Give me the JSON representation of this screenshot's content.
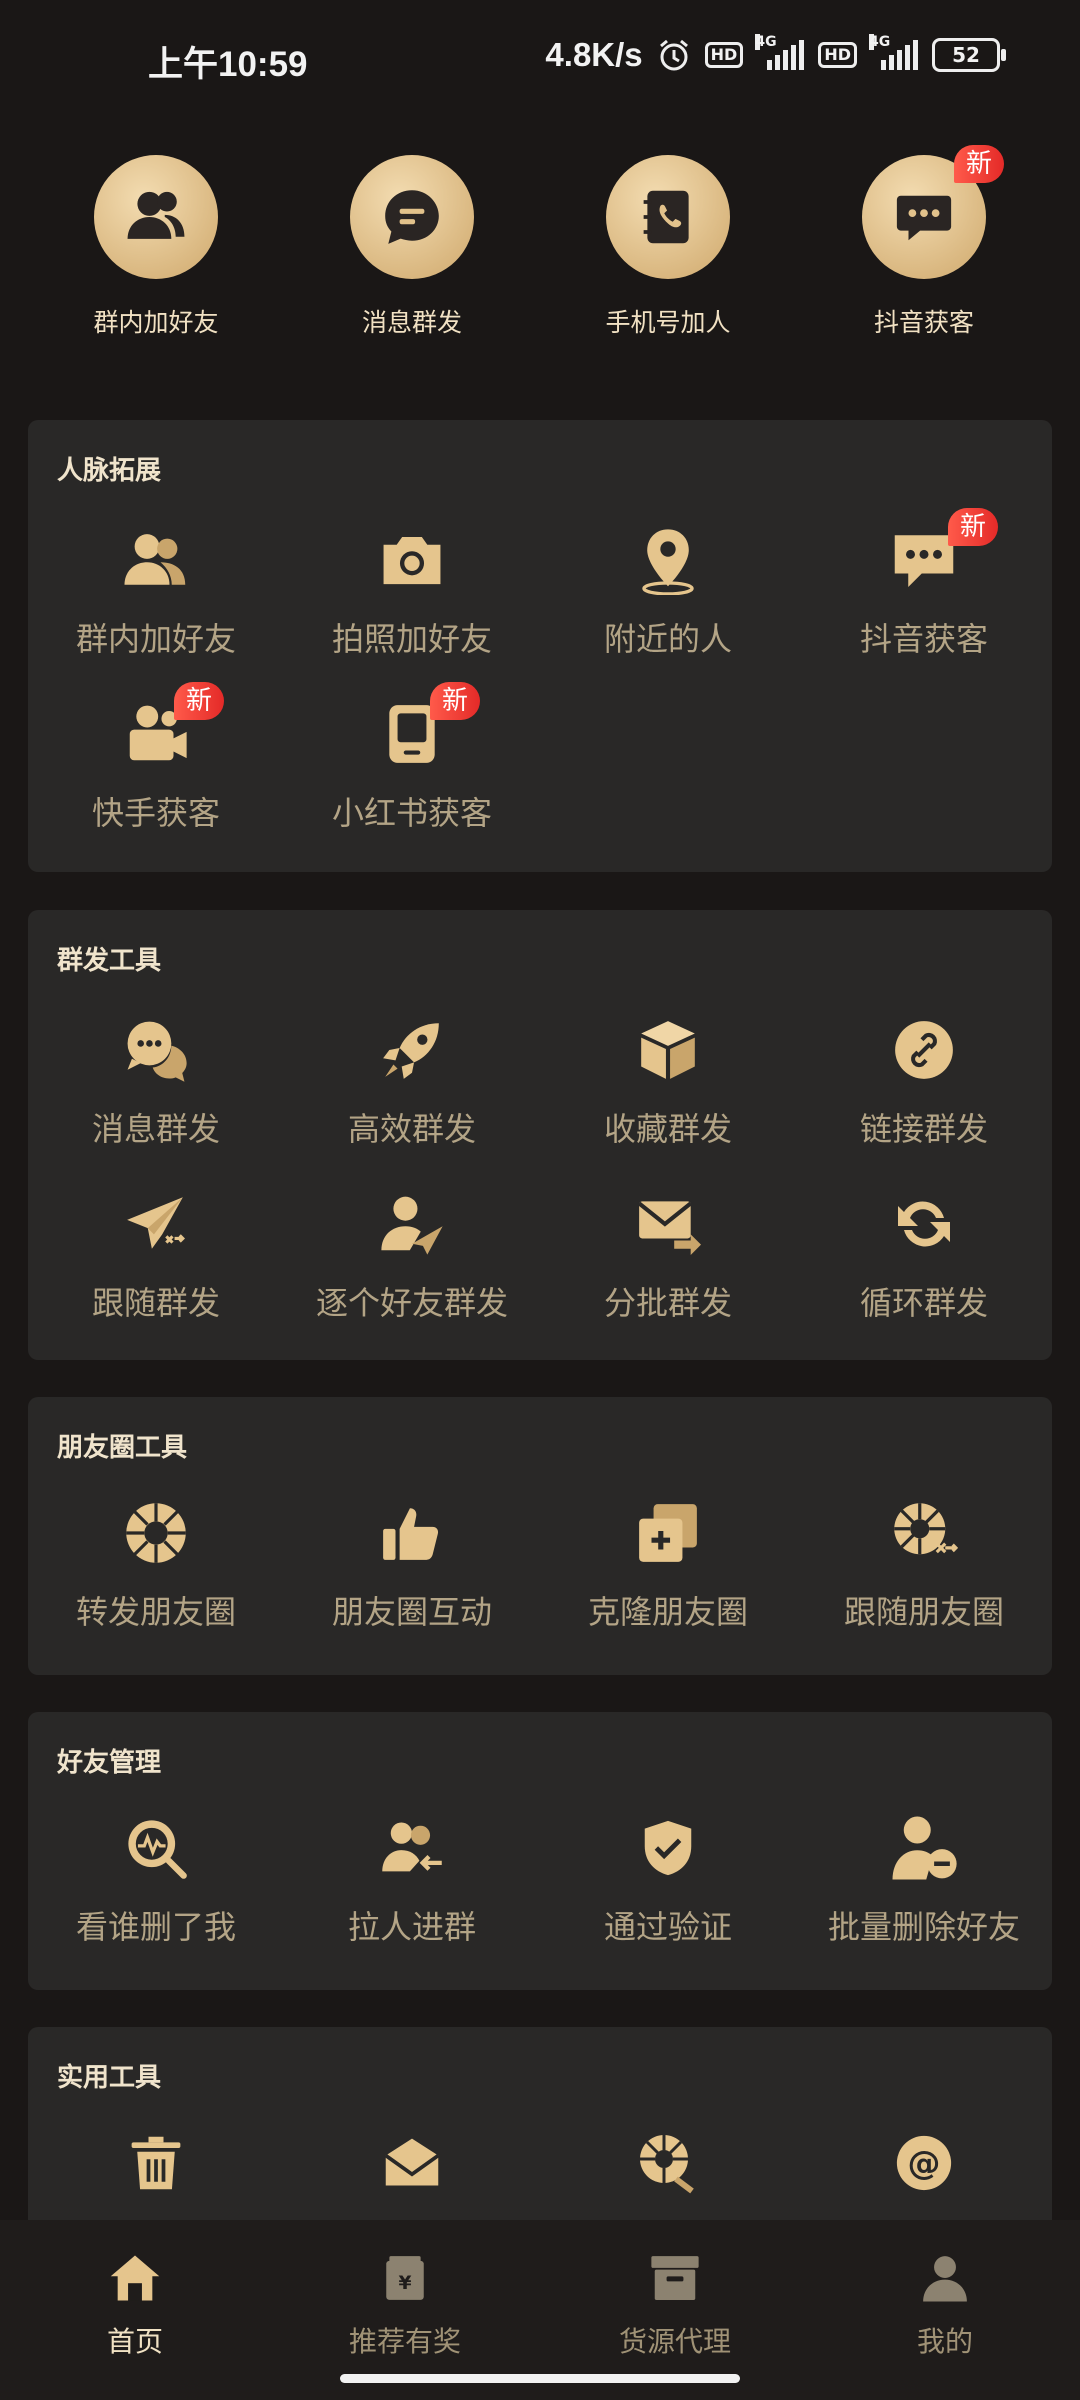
{
  "status": {
    "time": "上午10:59",
    "net_speed": "4.8K/s",
    "hd": "HD",
    "net_type": "4G",
    "battery": "52"
  },
  "quick_actions": [
    {
      "label": "群内加好友",
      "icon": "users-icon"
    },
    {
      "label": "消息群发",
      "icon": "message-icon"
    },
    {
      "label": "手机号加人",
      "icon": "phonebook-icon"
    },
    {
      "label": "抖音获客",
      "icon": "chat-dots-icon",
      "badge": "新"
    }
  ],
  "sections": [
    {
      "title": "人脉拓展",
      "items": [
        {
          "label": "群内加好友",
          "icon": "users-icon"
        },
        {
          "label": "拍照加好友",
          "icon": "camera-icon"
        },
        {
          "label": "附近的人",
          "icon": "location-pin-icon"
        },
        {
          "label": "抖音获客",
          "icon": "chat-dots-icon",
          "badge": "新"
        },
        {
          "label": "快手获客",
          "icon": "video-camera-icon",
          "badge": "新"
        },
        {
          "label": "小红书获客",
          "icon": "book-icon",
          "badge": "新"
        }
      ]
    },
    {
      "title": "群发工具",
      "items": [
        {
          "label": "消息群发",
          "icon": "chat-bubbles-icon"
        },
        {
          "label": "高效群发",
          "icon": "rocket-icon"
        },
        {
          "label": "收藏群发",
          "icon": "box-icon"
        },
        {
          "label": "链接群发",
          "icon": "link-icon"
        },
        {
          "label": "跟随群发",
          "icon": "paper-plane-icon"
        },
        {
          "label": "逐个好友群发",
          "icon": "user-send-icon"
        },
        {
          "label": "分批群发",
          "icon": "mail-forward-icon"
        },
        {
          "label": "循环群发",
          "icon": "refresh-icon"
        }
      ]
    },
    {
      "title": "朋友圈工具",
      "items": [
        {
          "label": "转发朋友圈",
          "icon": "aperture-icon"
        },
        {
          "label": "朋友圈互动",
          "icon": "thumbs-up-icon"
        },
        {
          "label": "克隆朋友圈",
          "icon": "clone-icon"
        },
        {
          "label": "跟随朋友圈",
          "icon": "aperture-shuffle-icon"
        }
      ]
    },
    {
      "title": "好友管理",
      "items": [
        {
          "label": "看谁删了我",
          "icon": "search-pulse-icon"
        },
        {
          "label": "拉人进群",
          "icon": "users-add-icon"
        },
        {
          "label": "通过验证",
          "icon": "shield-check-icon"
        },
        {
          "label": "批量删除好友",
          "icon": "user-remove-icon"
        }
      ]
    },
    {
      "title": "实用工具",
      "items": [
        {
          "label": "",
          "icon": "trash-icon"
        },
        {
          "label": "",
          "icon": "envelope-icon"
        },
        {
          "label": "",
          "icon": "aperture-broom-icon"
        },
        {
          "label": "",
          "icon": "at-icon"
        }
      ]
    }
  ],
  "bottom_nav": [
    {
      "label": "首页",
      "icon": "home-icon",
      "active": true
    },
    {
      "label": "推荐有奖",
      "icon": "gift-bag-icon"
    },
    {
      "label": "货源代理",
      "icon": "archive-box-icon"
    },
    {
      "label": "我的",
      "icon": "profile-icon"
    }
  ],
  "colors": {
    "background": "#1a1716",
    "card": "#292827",
    "gold": "#e5c58d",
    "badge": "#e42a28"
  }
}
